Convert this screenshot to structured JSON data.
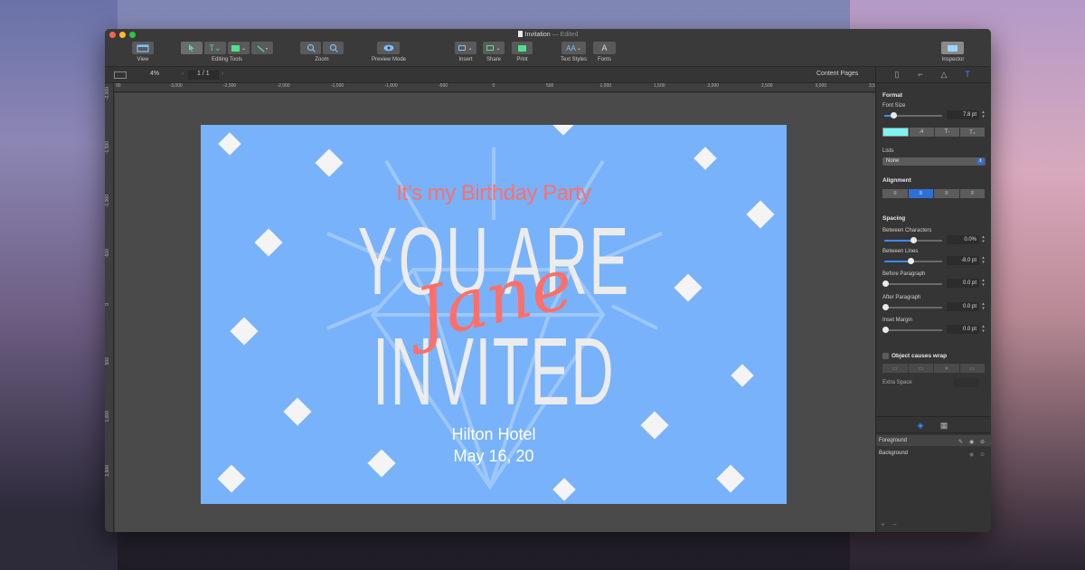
{
  "window": {
    "title": "Invitation",
    "edited": "— Edited"
  },
  "toolbar": {
    "view_label": "View",
    "editing_tools_label": "Editing Tools",
    "zoom_label": "Zoom",
    "preview_label": "Preview Mode",
    "insert_label": "Insert",
    "share_label": "Share",
    "print_label": "Print",
    "text_styles_label": "Text Styles",
    "fonts_label": "Fonts",
    "inspector_label": "Inspector"
  },
  "subbar": {
    "zoom": "4%",
    "page_indicator": "1 / 1",
    "content_pages": "Content Pages"
  },
  "ruler": {
    "h_ticks": [
      "00",
      "-3,000",
      "-2,500",
      "-2,000",
      "-1,500",
      "-1,000",
      "-500",
      "0",
      "500",
      "1,000",
      "1,500",
      "2,000",
      "2,500",
      "3,000",
      "3,500"
    ],
    "v_ticks": [
      "-2,000",
      "-1,500",
      "-1,000",
      "-500",
      "0",
      "500",
      "1,000",
      "1,500"
    ]
  },
  "invitation": {
    "tagline": "It’s my Birthday Party",
    "line1": "YOU ARE",
    "name": "Jane",
    "line2": "INVITED",
    "venue": "Hilton Hotel",
    "date": "May 16, 20"
  },
  "inspector": {
    "format": "Format",
    "font_size_label": "Font Size",
    "font_size": "7.8 pt",
    "font_size_level": 0.15,
    "lists_label": "Lists",
    "lists_value": "None",
    "alignment_label": "Alignment",
    "spacing_label": "Spacing",
    "between_chars_label": "Between Characters",
    "between_chars": "0.0%",
    "between_chars_level": 0.5,
    "between_lines_label": "Between Lines",
    "between_lines": "-8.0 pt",
    "between_lines_level": 0.45,
    "before_para_label": "Before Paragraph",
    "before_para": "0.0 pt",
    "after_para_label": "After Paragraph",
    "after_para": "0.0 pt",
    "inset_label": "Inset Margin",
    "inset": "0.0 pt",
    "wrap_label": "Object causes wrap",
    "extra_space_label": "Extra Space",
    "text_color": "#7df3f3"
  },
  "layers": {
    "foreground": "Foreground",
    "background": "Background"
  },
  "colors": {
    "page_bg": "#78b2fa",
    "accent": "#ff6f69",
    "ui_blue": "#2f6fd8"
  }
}
